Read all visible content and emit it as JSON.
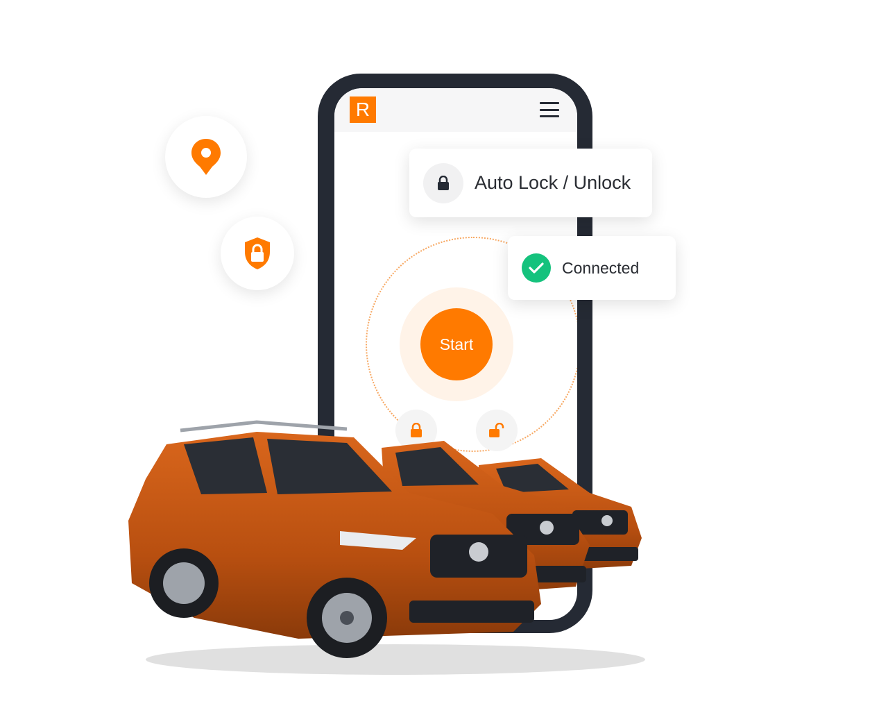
{
  "app": {
    "logo_letter": "R",
    "start_label": "Start"
  },
  "cards": {
    "autolock_label": "Auto Lock / Unlock",
    "connected_label": "Connected"
  },
  "icons": {
    "location": "map-pin-icon",
    "security": "shield-lock-icon",
    "menu": "hamburger-menu-icon",
    "lock": "lock-icon",
    "unlock": "unlock-icon",
    "check": "check-icon"
  },
  "colors": {
    "brand_orange": "#ff7a00",
    "phone_frame": "#252a34",
    "success_green": "#15c27d",
    "ring_dots": "#f7a863"
  }
}
